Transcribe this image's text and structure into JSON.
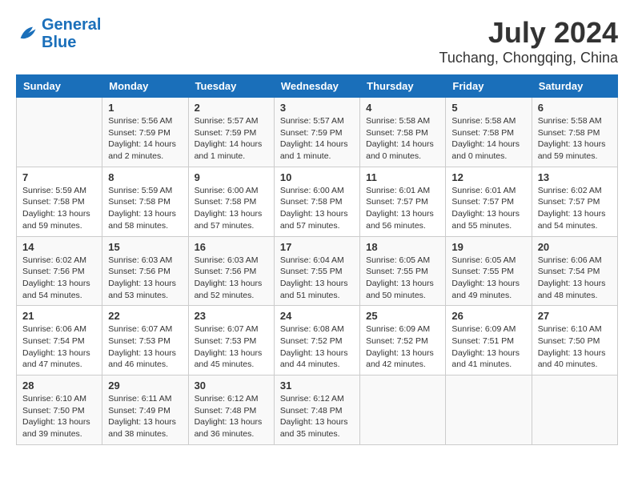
{
  "header": {
    "logo_general": "General",
    "logo_blue": "Blue",
    "main_title": "July 2024",
    "subtitle": "Tuchang, Chongqing, China"
  },
  "calendar": {
    "days_of_week": [
      "Sunday",
      "Monday",
      "Tuesday",
      "Wednesday",
      "Thursday",
      "Friday",
      "Saturday"
    ],
    "weeks": [
      [
        {
          "day": "",
          "info": ""
        },
        {
          "day": "1",
          "info": "Sunrise: 5:56 AM\nSunset: 7:59 PM\nDaylight: 14 hours\nand 2 minutes."
        },
        {
          "day": "2",
          "info": "Sunrise: 5:57 AM\nSunset: 7:59 PM\nDaylight: 14 hours\nand 1 minute."
        },
        {
          "day": "3",
          "info": "Sunrise: 5:57 AM\nSunset: 7:59 PM\nDaylight: 14 hours\nand 1 minute."
        },
        {
          "day": "4",
          "info": "Sunrise: 5:58 AM\nSunset: 7:58 PM\nDaylight: 14 hours\nand 0 minutes."
        },
        {
          "day": "5",
          "info": "Sunrise: 5:58 AM\nSunset: 7:58 PM\nDaylight: 14 hours\nand 0 minutes."
        },
        {
          "day": "6",
          "info": "Sunrise: 5:58 AM\nSunset: 7:58 PM\nDaylight: 13 hours\nand 59 minutes."
        }
      ],
      [
        {
          "day": "7",
          "info": "Sunrise: 5:59 AM\nSunset: 7:58 PM\nDaylight: 13 hours\nand 59 minutes."
        },
        {
          "day": "8",
          "info": "Sunrise: 5:59 AM\nSunset: 7:58 PM\nDaylight: 13 hours\nand 58 minutes."
        },
        {
          "day": "9",
          "info": "Sunrise: 6:00 AM\nSunset: 7:58 PM\nDaylight: 13 hours\nand 57 minutes."
        },
        {
          "day": "10",
          "info": "Sunrise: 6:00 AM\nSunset: 7:58 PM\nDaylight: 13 hours\nand 57 minutes."
        },
        {
          "day": "11",
          "info": "Sunrise: 6:01 AM\nSunset: 7:57 PM\nDaylight: 13 hours\nand 56 minutes."
        },
        {
          "day": "12",
          "info": "Sunrise: 6:01 AM\nSunset: 7:57 PM\nDaylight: 13 hours\nand 55 minutes."
        },
        {
          "day": "13",
          "info": "Sunrise: 6:02 AM\nSunset: 7:57 PM\nDaylight: 13 hours\nand 54 minutes."
        }
      ],
      [
        {
          "day": "14",
          "info": "Sunrise: 6:02 AM\nSunset: 7:56 PM\nDaylight: 13 hours\nand 54 minutes."
        },
        {
          "day": "15",
          "info": "Sunrise: 6:03 AM\nSunset: 7:56 PM\nDaylight: 13 hours\nand 53 minutes."
        },
        {
          "day": "16",
          "info": "Sunrise: 6:03 AM\nSunset: 7:56 PM\nDaylight: 13 hours\nand 52 minutes."
        },
        {
          "day": "17",
          "info": "Sunrise: 6:04 AM\nSunset: 7:55 PM\nDaylight: 13 hours\nand 51 minutes."
        },
        {
          "day": "18",
          "info": "Sunrise: 6:05 AM\nSunset: 7:55 PM\nDaylight: 13 hours\nand 50 minutes."
        },
        {
          "day": "19",
          "info": "Sunrise: 6:05 AM\nSunset: 7:55 PM\nDaylight: 13 hours\nand 49 minutes."
        },
        {
          "day": "20",
          "info": "Sunrise: 6:06 AM\nSunset: 7:54 PM\nDaylight: 13 hours\nand 48 minutes."
        }
      ],
      [
        {
          "day": "21",
          "info": "Sunrise: 6:06 AM\nSunset: 7:54 PM\nDaylight: 13 hours\nand 47 minutes."
        },
        {
          "day": "22",
          "info": "Sunrise: 6:07 AM\nSunset: 7:53 PM\nDaylight: 13 hours\nand 46 minutes."
        },
        {
          "day": "23",
          "info": "Sunrise: 6:07 AM\nSunset: 7:53 PM\nDaylight: 13 hours\nand 45 minutes."
        },
        {
          "day": "24",
          "info": "Sunrise: 6:08 AM\nSunset: 7:52 PM\nDaylight: 13 hours\nand 44 minutes."
        },
        {
          "day": "25",
          "info": "Sunrise: 6:09 AM\nSunset: 7:52 PM\nDaylight: 13 hours\nand 42 minutes."
        },
        {
          "day": "26",
          "info": "Sunrise: 6:09 AM\nSunset: 7:51 PM\nDaylight: 13 hours\nand 41 minutes."
        },
        {
          "day": "27",
          "info": "Sunrise: 6:10 AM\nSunset: 7:50 PM\nDaylight: 13 hours\nand 40 minutes."
        }
      ],
      [
        {
          "day": "28",
          "info": "Sunrise: 6:10 AM\nSunset: 7:50 PM\nDaylight: 13 hours\nand 39 minutes."
        },
        {
          "day": "29",
          "info": "Sunrise: 6:11 AM\nSunset: 7:49 PM\nDaylight: 13 hours\nand 38 minutes."
        },
        {
          "day": "30",
          "info": "Sunrise: 6:12 AM\nSunset: 7:48 PM\nDaylight: 13 hours\nand 36 minutes."
        },
        {
          "day": "31",
          "info": "Sunrise: 6:12 AM\nSunset: 7:48 PM\nDaylight: 13 hours\nand 35 minutes."
        },
        {
          "day": "",
          "info": ""
        },
        {
          "day": "",
          "info": ""
        },
        {
          "day": "",
          "info": ""
        }
      ]
    ]
  }
}
